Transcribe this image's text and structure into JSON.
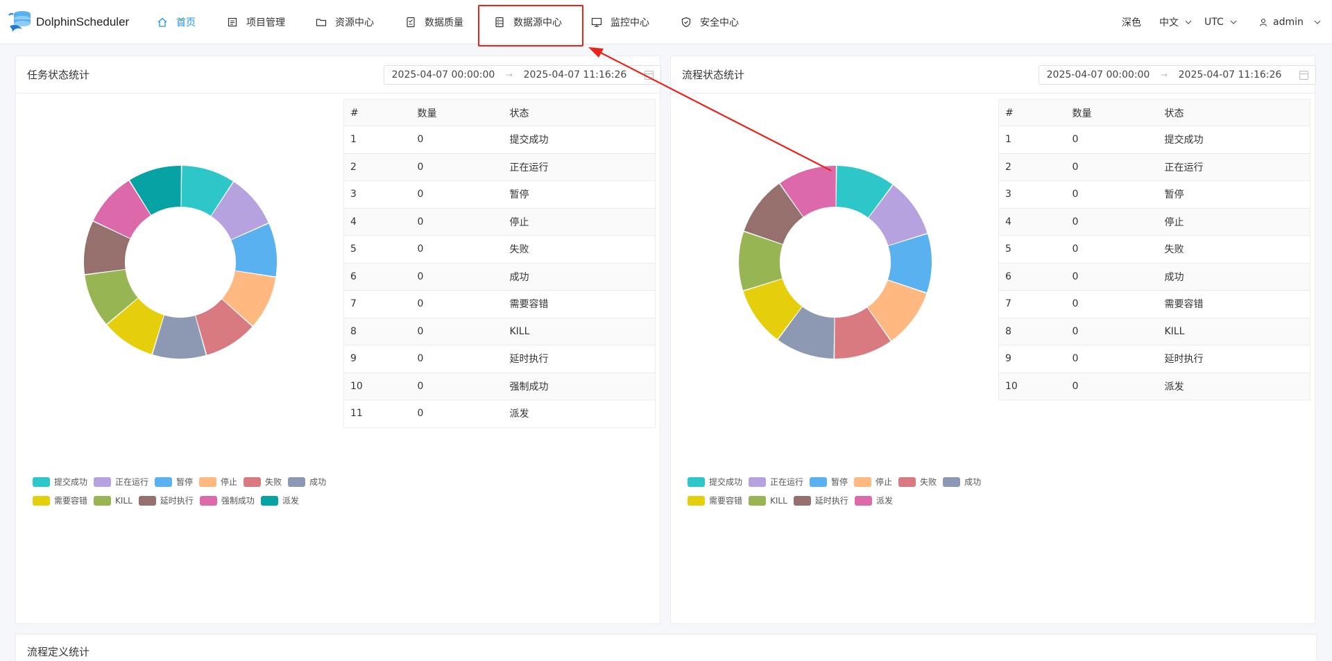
{
  "app": {
    "name": "DolphinScheduler"
  },
  "nav": {
    "items": [
      {
        "label": "首页",
        "icon": "home-icon",
        "active": true
      },
      {
        "label": "项目管理",
        "icon": "project-icon"
      },
      {
        "label": "资源中心",
        "icon": "folder-icon"
      },
      {
        "label": "数据质量",
        "icon": "data-quality-icon"
      },
      {
        "label": "数据源中心",
        "icon": "datasource-icon",
        "highlighted": true
      },
      {
        "label": "监控中心",
        "icon": "monitor-icon"
      },
      {
        "label": "安全中心",
        "icon": "shield-icon"
      }
    ],
    "theme_label": "深色",
    "language_label": "中文",
    "timezone_label": "UTC",
    "user_label": "admin"
  },
  "colors": {
    "accent": "#1890ff",
    "highlight_box": "#e8231a",
    "slice": [
      "#2ec7c9",
      "#b6a2de",
      "#5ab1ef",
      "#ffb980",
      "#d87a80",
      "#8d98b3",
      "#e5cf0d",
      "#97b552",
      "#95706d",
      "#dc69aa",
      "#07a2a4"
    ]
  },
  "task_stats": {
    "title": "任务状态统计",
    "start": "2025-04-07 00:00:00",
    "end": "2025-04-07 11:16:26",
    "headers": [
      "#",
      "数量",
      "状态"
    ],
    "rows": [
      [
        "1",
        "0",
        "提交成功"
      ],
      [
        "2",
        "0",
        "正在运行"
      ],
      [
        "3",
        "0",
        "暂停"
      ],
      [
        "4",
        "0",
        "停止"
      ],
      [
        "5",
        "0",
        "失败"
      ],
      [
        "6",
        "0",
        "成功"
      ],
      [
        "7",
        "0",
        "需要容错"
      ],
      [
        "8",
        "0",
        "KILL"
      ],
      [
        "9",
        "0",
        "延时执行"
      ],
      [
        "10",
        "0",
        "强制成功"
      ],
      [
        "11",
        "0",
        "派发"
      ]
    ]
  },
  "process_stats": {
    "title": "流程状态统计",
    "start": "2025-04-07 00:00:00",
    "end": "2025-04-07 11:16:26",
    "headers": [
      "#",
      "数量",
      "状态"
    ],
    "rows": [
      [
        "1",
        "0",
        "提交成功"
      ],
      [
        "2",
        "0",
        "正在运行"
      ],
      [
        "3",
        "0",
        "暂停"
      ],
      [
        "4",
        "0",
        "停止"
      ],
      [
        "5",
        "0",
        "失败"
      ],
      [
        "6",
        "0",
        "成功"
      ],
      [
        "7",
        "0",
        "需要容错"
      ],
      [
        "8",
        "0",
        "KILL"
      ],
      [
        "9",
        "0",
        "延时执行"
      ],
      [
        "10",
        "0",
        "派发"
      ]
    ]
  },
  "definition_stats": {
    "title": "流程定义统计"
  },
  "chart_data": [
    {
      "type": "pie",
      "categories": [
        "提交成功",
        "正在运行",
        "暂停",
        "停止",
        "失败",
        "成功",
        "需要容错",
        "KILL",
        "延时执行",
        "强制成功",
        "派发"
      ],
      "values": [
        0,
        0,
        0,
        0,
        0,
        0,
        0,
        0,
        0,
        0,
        0
      ],
      "legend": "bottom-left"
    },
    {
      "type": "pie",
      "categories": [
        "提交成功",
        "正在运行",
        "暂停",
        "停止",
        "失败",
        "成功",
        "需要容错",
        "KILL",
        "延时执行",
        "派发"
      ],
      "values": [
        0,
        0,
        0,
        0,
        0,
        0,
        0,
        0,
        0,
        0
      ],
      "legend": "bottom-left"
    }
  ]
}
